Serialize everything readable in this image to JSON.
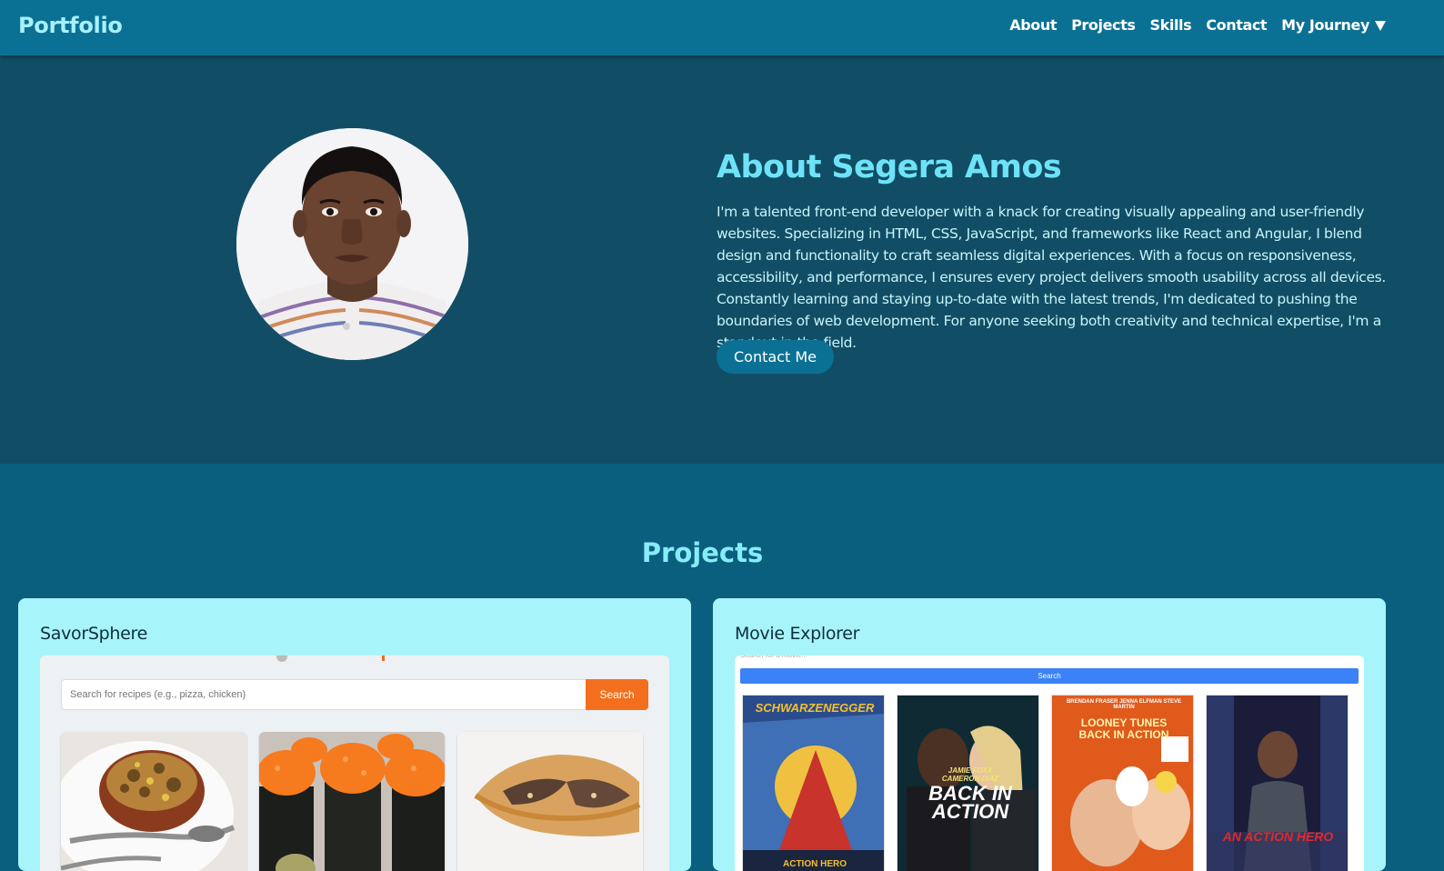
{
  "nav": {
    "brand": "Portfolio",
    "links": [
      "About",
      "Projects",
      "Skills",
      "Contact",
      "My Journey"
    ]
  },
  "about": {
    "title": "About Segera Amos",
    "text": "I'm a talented front-end developer with a knack for creating visually appealing and user-friendly websites. Specializing in HTML, CSS, JavaScript, and frameworks like React and Angular, I blend design and functionality to craft seamless digital experiences. With a focus on responsiveness, accessibility, and performance, I ensures every project delivers smooth usability across all devices. Constantly learning and staying up-to-date with the latest trends, I'm dedicated to pushing the boundaries of web development. For anyone seeking both creativity and technical expertise, I'm a standout in the field.",
    "cta": "Contact Me"
  },
  "projects": {
    "title": "Projects",
    "cards": [
      {
        "title": "SavorSphere",
        "search_placeholder": "Search for recipes (e.g., pizza, chicken)",
        "search_button": "Search"
      },
      {
        "title": "Movie Explorer",
        "search_placeholder": "Search for a movie...",
        "search_button": "Search",
        "posters": [
          {
            "top": "SCHWARZENEGGER",
            "bottom": "ACTION HERO"
          },
          {
            "top": "JAMIE FOXX\nCAMERON DIAZ",
            "bottom": "BACK IN ACTION"
          },
          {
            "top": "BRENDAN FRASER  JENNA ELFMAN  STEVE MARTIN",
            "bottom": "LOONEY TUNES BACK IN ACTION"
          },
          {
            "top": "",
            "bottom": "AN ACTION HERO"
          }
        ]
      }
    ]
  },
  "colors": {
    "nav_bg": "#0b7194",
    "about_bg": "#114e65",
    "projects_bg": "#0b5f7e",
    "accent": "#6ee3f7",
    "card_bg": "#a7f4fb",
    "orange": "#f36f1d",
    "blue": "#3b82f6"
  }
}
